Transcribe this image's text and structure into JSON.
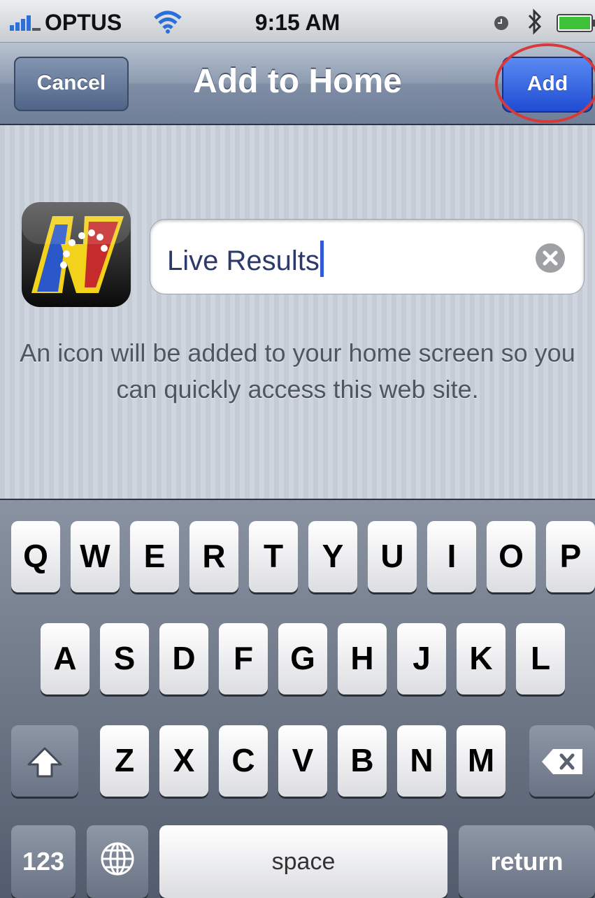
{
  "status_bar": {
    "carrier": "OPTUS",
    "time": "9:15 AM",
    "icons": [
      "signal-bars-icon",
      "wifi-icon",
      "clock-icon",
      "bluetooth-icon",
      "battery-icon"
    ]
  },
  "nav_bar": {
    "title": "Add to Home",
    "cancel_label": "Cancel",
    "add_label": "Add"
  },
  "form": {
    "name_value": "Live Results",
    "hint": "An icon will be added to your home screen so you can quickly access this web site."
  },
  "keyboard": {
    "row1": [
      "Q",
      "W",
      "E",
      "R",
      "T",
      "Y",
      "U",
      "I",
      "O",
      "P"
    ],
    "row2": [
      "A",
      "S",
      "D",
      "F",
      "G",
      "H",
      "J",
      "K",
      "L"
    ],
    "row3": [
      "Z",
      "X",
      "C",
      "V",
      "B",
      "N",
      "M"
    ],
    "numbers_label": "123",
    "space_label": "space",
    "return_label": "return"
  },
  "colors": {
    "add_button": "#1f4cd2",
    "highlight_ring": "#d83a3a",
    "cursor": "#2f5bd9"
  }
}
